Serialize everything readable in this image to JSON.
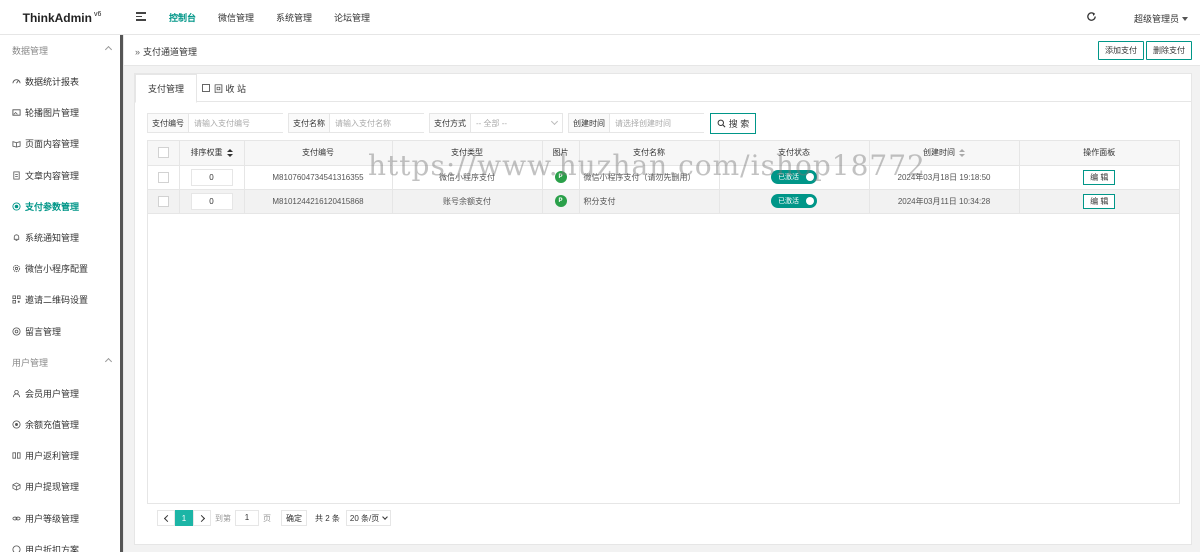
{
  "app": {
    "logo": "ThinkAdmin",
    "version": "v6"
  },
  "topnav": [
    "控制台",
    "微信管理",
    "系统管理",
    "论坛管理"
  ],
  "user": {
    "name": "超级管理员"
  },
  "sidebar": {
    "groups": [
      {
        "title": "数据管理",
        "items": [
          {
            "label": "数据统计报表",
            "icon": "chart-icon"
          },
          {
            "label": "轮播图片管理",
            "icon": "image-icon"
          },
          {
            "label": "页面内容管理",
            "icon": "book-icon"
          },
          {
            "label": "文章内容管理",
            "icon": "article-icon"
          },
          {
            "label": "支付参数管理",
            "icon": "radio-icon",
            "active": true
          },
          {
            "label": "系统通知管理",
            "icon": "bell-icon"
          },
          {
            "label": "微信小程序配置",
            "icon": "settings-icon"
          },
          {
            "label": "邀请二维码设置",
            "icon": "qrcode-icon"
          },
          {
            "label": "留言管理",
            "icon": "at-icon"
          }
        ]
      },
      {
        "title": "用户管理",
        "items": [
          {
            "label": "会员用户管理",
            "icon": "user-icon"
          },
          {
            "label": "余额充值管理",
            "icon": "coin-icon"
          },
          {
            "label": "用户返利管理",
            "icon": "rebate-icon"
          },
          {
            "label": "用户提现管理",
            "icon": "cube-icon"
          },
          {
            "label": "用户等级管理",
            "icon": "link-icon"
          },
          {
            "label": "用户折扣方案",
            "icon": "discount-icon"
          }
        ]
      }
    ]
  },
  "breadcrumb": {
    "arrows": "»",
    "title": "支付通道管理"
  },
  "actions": {
    "add": "添加支付",
    "delete": "删除支付"
  },
  "tabs": {
    "active": "支付管理",
    "recycle": "回 收 站"
  },
  "filters": {
    "code_label": "支付编号",
    "code_placeholder": "请输入支付编号",
    "name_label": "支付名称",
    "name_placeholder": "请输入支付名称",
    "type_label": "支付方式",
    "type_value": "-- 全部 --",
    "time_label": "创建时间",
    "time_placeholder": "请选择创建时间",
    "search": "搜 索"
  },
  "table": {
    "headers": [
      "排序权重",
      "支付编号",
      "支付类型",
      "图片",
      "支付名称",
      "支付状态",
      "创建时间",
      "操作面板"
    ],
    "rows": [
      {
        "sort": "0",
        "code": "M8107604734541316355",
        "type": "微信小程序支付",
        "img": "P",
        "name": "微信小程序支付（请勿先删用）",
        "status": "已激活",
        "time": "2024年03月18日 19:18:50",
        "action": "编 辑"
      },
      {
        "sort": "0",
        "code": "M8101244216120415868",
        "type": "账号余额支付",
        "img": "P",
        "name": "积分支付",
        "status": "已激活",
        "time": "2024年03月11日 10:34:28",
        "action": "编 辑"
      }
    ]
  },
  "pager": {
    "current": "1",
    "goto_label": "到第",
    "goto_value": "1",
    "page_label": "页",
    "confirm": "确定",
    "total": "共 2 条",
    "size": "20 条/页"
  },
  "watermark": "https://www.huzhan.com/ishop18772",
  "colors": {
    "accent": "#009688",
    "page_current": "#1cb5a6"
  }
}
